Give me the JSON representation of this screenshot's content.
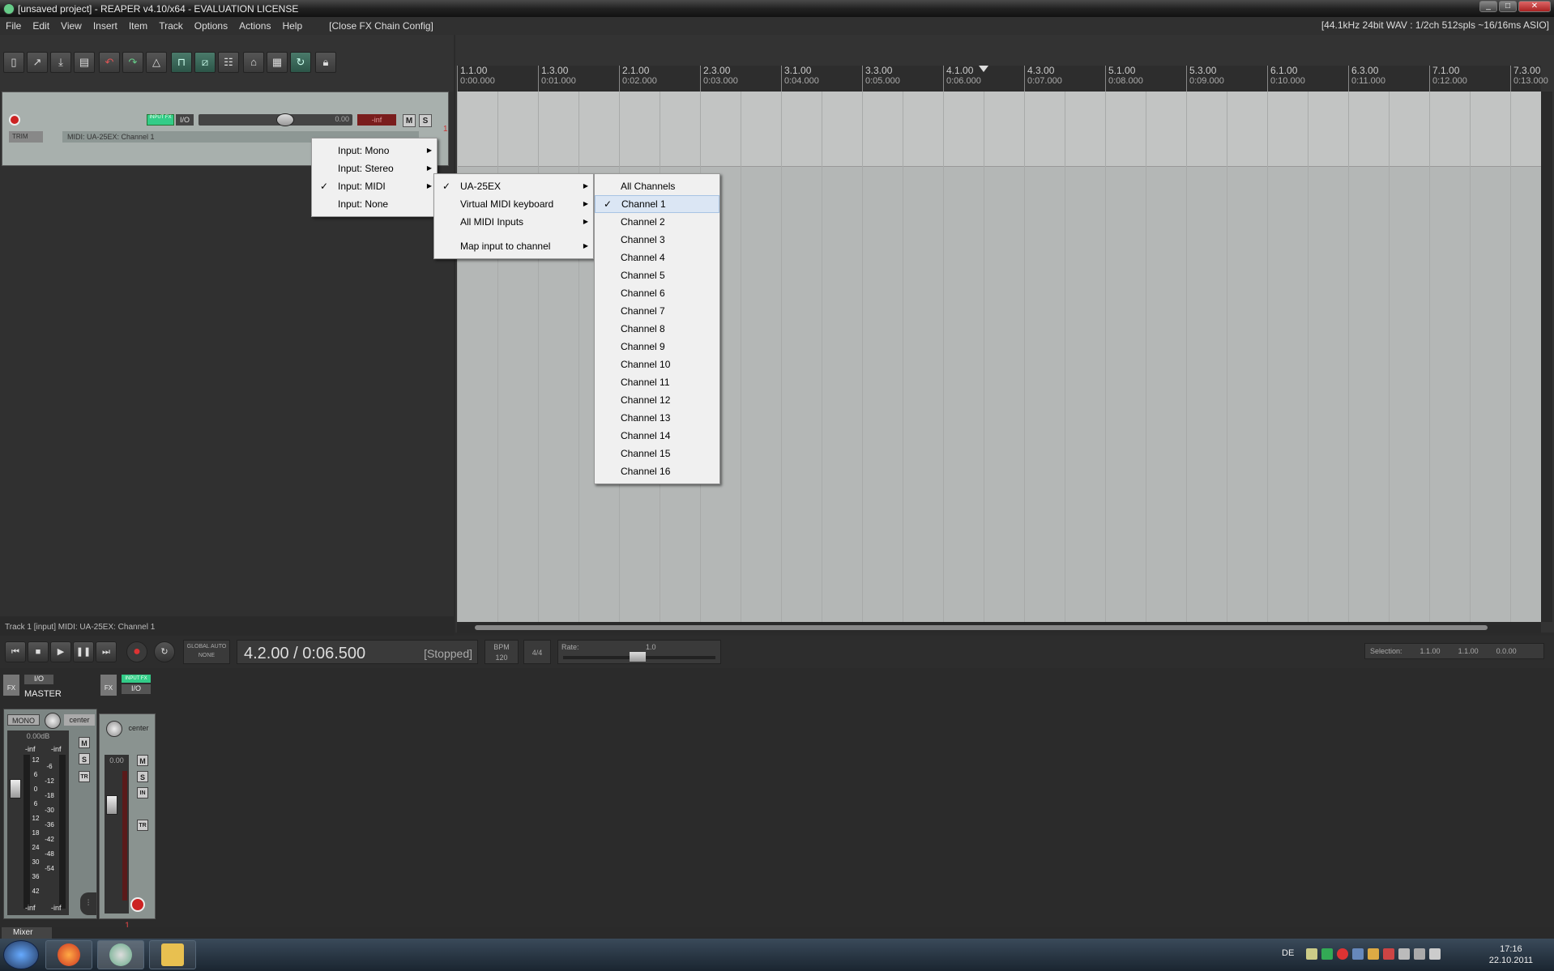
{
  "window": {
    "title": "[unsaved project] - REAPER v4.10/x64 - EVALUATION LICENSE",
    "minimize": "_",
    "maximize": "□",
    "close": "✕"
  },
  "menubar": {
    "items": [
      "File",
      "Edit",
      "View",
      "Insert",
      "Item",
      "Track",
      "Options",
      "Actions",
      "Help"
    ],
    "fx_chain_close": "[Close FX Chain Config]",
    "audio_info": "[44.1kHz 24bit WAV : 1/2ch 512spls ~16/16ms ASIO]"
  },
  "toolbar": {
    "icons": [
      "new-project-icon",
      "open-project-icon",
      "save-project-icon",
      "project-settings-icon",
      "undo-icon",
      "redo-icon",
      "metronome-icon",
      "snap-icon",
      "ripple-edit-icon",
      "grouping-icon",
      "envelope-icon",
      "grid-icon",
      "loop-icon",
      "lock-icon"
    ]
  },
  "track": {
    "input_fx_label": "INPUT FX",
    "io_label": "I/O",
    "volume_value": "0.00",
    "meter_value": "-inf",
    "mute_label": "M",
    "solo_label": "S",
    "trim_label": "TRIM",
    "input_label": "MIDI: UA-25EX: Channel 1",
    "number": "1"
  },
  "status_text": "Track 1 [input] MIDI: UA-25EX: Channel 1",
  "ruler": {
    "markers": [
      {
        "bar": "1.1.00",
        "time": "0:00.000"
      },
      {
        "bar": "1.3.00",
        "time": "0:01.000"
      },
      {
        "bar": "2.1.00",
        "time": "0:02.000"
      },
      {
        "bar": "2.3.00",
        "time": "0:03.000"
      },
      {
        "bar": "3.1.00",
        "time": "0:04.000"
      },
      {
        "bar": "3.3.00",
        "time": "0:05.000"
      },
      {
        "bar": "4.1.00",
        "time": "0:06.000"
      },
      {
        "bar": "4.3.00",
        "time": "0:07.000"
      },
      {
        "bar": "5.1.00",
        "time": "0:08.000"
      },
      {
        "bar": "5.3.00",
        "time": "0:09.000"
      },
      {
        "bar": "6.1.00",
        "time": "0:10.000"
      },
      {
        "bar": "6.3.00",
        "time": "0:11.000"
      },
      {
        "bar": "7.1.00",
        "time": "0:12.000"
      },
      {
        "bar": "7.3.00",
        "time": "0:13.000"
      }
    ]
  },
  "transport": {
    "global_auto_label": "GLOBAL AUTO",
    "global_auto_value": "NONE",
    "time": "4.2.00 / 0:06.500",
    "state": "[Stopped]",
    "bpm_label": "BPM",
    "bpm_value": "120",
    "time_signature": "4/4",
    "rate_label": "Rate:",
    "rate_value": "1.0",
    "selection_label": "Selection:",
    "selection_start": "1.1.00",
    "selection_end": "1.1.00",
    "selection_length": "0.0.00"
  },
  "mixer": {
    "master": {
      "fx_label": "FX",
      "io_label": "I/O",
      "name": "MASTER",
      "mono_label": "MONO",
      "pan_label": "center",
      "volume": "0.00dB",
      "peak_left": "-inf",
      "peak_right": "-inf",
      "bottom_left": "-inf",
      "bottom_right": "-inf",
      "mute_label": "M",
      "solo_label": "S",
      "tr_label": "TR",
      "scale": [
        "12",
        "6",
        "0",
        "6",
        "12",
        "18",
        "24",
        "30",
        "36",
        "42"
      ],
      "scale_inner": [
        "-6",
        "-12",
        "-18",
        "-30",
        "-36",
        "-42",
        "-48",
        "-54"
      ]
    },
    "track1": {
      "fx_label": "FX",
      "input_fx_label": "INPUT FX",
      "io_label": "I/O",
      "pan_label": "center",
      "volume": "0.00",
      "mute_label": "M",
      "solo_label": "S",
      "in_label": "IN",
      "tr_label": "TR",
      "number": "1"
    },
    "tab_label": "Mixer"
  },
  "context_menu": {
    "level1": [
      {
        "label": "Input: Mono",
        "checked": false,
        "submenu": true
      },
      {
        "label": "Input: Stereo",
        "checked": false,
        "submenu": true
      },
      {
        "label": "Input: MIDI",
        "checked": true,
        "submenu": true
      },
      {
        "label": "Input: None",
        "checked": false,
        "submenu": false
      }
    ],
    "level2": [
      {
        "label": "UA-25EX",
        "checked": true,
        "submenu": true
      },
      {
        "label": "Virtual MIDI keyboard",
        "checked": false,
        "submenu": true
      },
      {
        "label": "All MIDI Inputs",
        "checked": false,
        "submenu": true
      },
      {
        "label": "Map input to channel",
        "checked": false,
        "submenu": true
      }
    ],
    "level3": [
      {
        "label": "All Channels",
        "checked": false
      },
      {
        "label": "Channel 1",
        "checked": true
      },
      {
        "label": "Channel 2",
        "checked": false
      },
      {
        "label": "Channel 3",
        "checked": false
      },
      {
        "label": "Channel 4",
        "checked": false
      },
      {
        "label": "Channel 5",
        "checked": false
      },
      {
        "label": "Channel 6",
        "checked": false
      },
      {
        "label": "Channel 7",
        "checked": false
      },
      {
        "label": "Channel 8",
        "checked": false
      },
      {
        "label": "Channel 9",
        "checked": false
      },
      {
        "label": "Channel 10",
        "checked": false
      },
      {
        "label": "Channel 11",
        "checked": false
      },
      {
        "label": "Channel 12",
        "checked": false
      },
      {
        "label": "Channel 13",
        "checked": false
      },
      {
        "label": "Channel 14",
        "checked": false
      },
      {
        "label": "Channel 15",
        "checked": false
      },
      {
        "label": "Channel 16",
        "checked": false
      }
    ]
  },
  "taskbar": {
    "language": "DE",
    "time": "17:16",
    "date": "22.10.2011"
  },
  "colors": {
    "cursor": "#bb4444",
    "record": "#cc2222",
    "input_fx": "#33cc88",
    "menu_highlight": "#dbe6f4"
  }
}
